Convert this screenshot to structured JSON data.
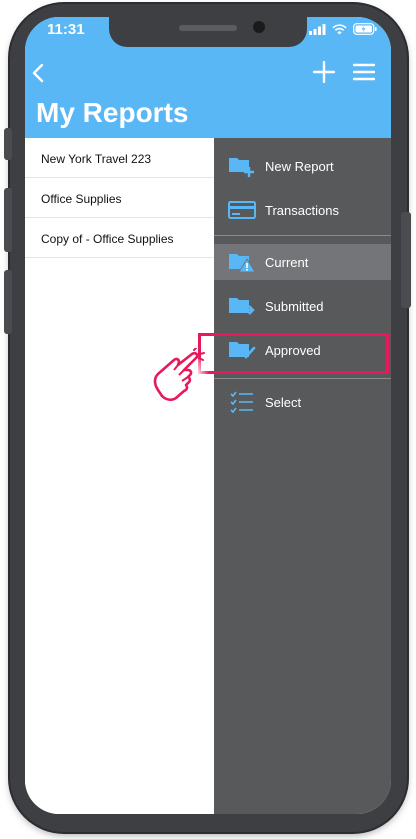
{
  "status_bar": {
    "time": "11:31"
  },
  "header": {
    "title": "My Reports",
    "back_icon": "chevron-left-icon",
    "add_icon": "plus-icon",
    "menu_icon": "hamburger-icon"
  },
  "reports": [
    {
      "name": "New York Travel 223"
    },
    {
      "name": "Office Supplies"
    },
    {
      "name": "Copy of - Office Supplies"
    }
  ],
  "menu": {
    "new_report": "New Report",
    "transactions": "Transactions",
    "current": "Current",
    "submitted": "Submitted",
    "approved": "Approved",
    "select": "Select"
  },
  "colors": {
    "header_bg": "#5ab7f6",
    "menu_bg": "#58595b",
    "menu_icon": "#5ab7f6",
    "selected_bg": "#747578",
    "highlight": "#e6195a"
  }
}
